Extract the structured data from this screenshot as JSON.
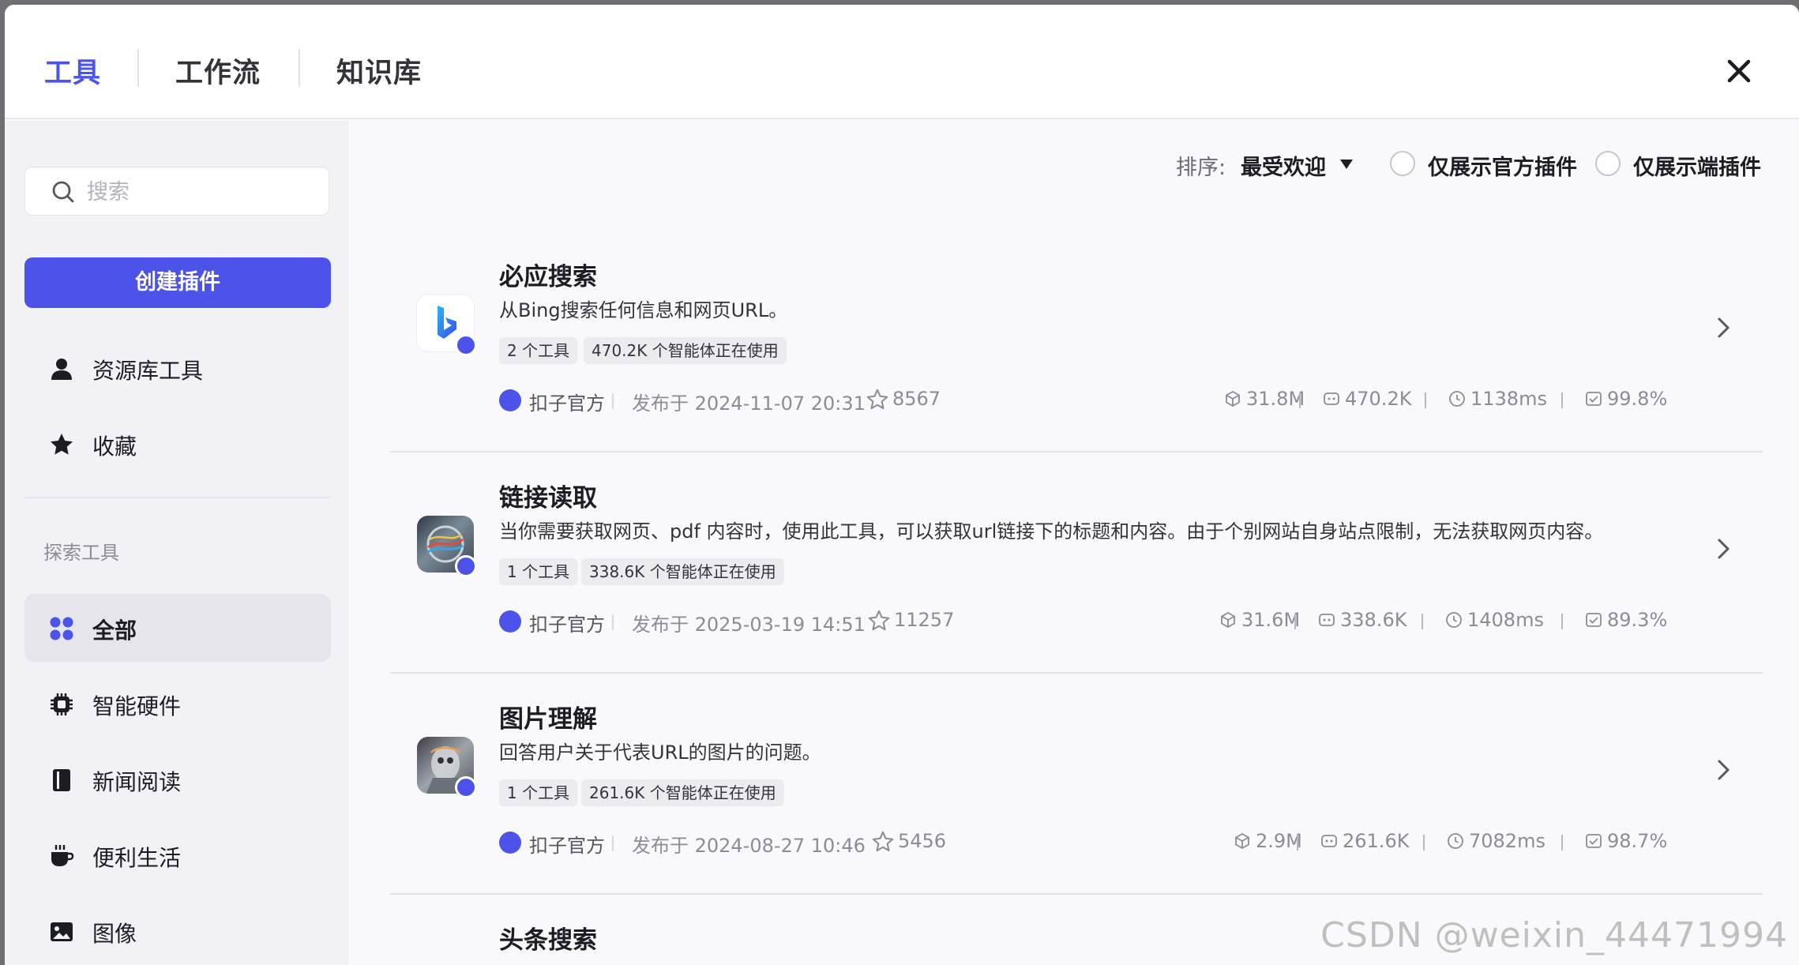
{
  "tabs": [
    {
      "label": "工具",
      "active": true
    },
    {
      "label": "工作流",
      "active": false
    },
    {
      "label": "知识库",
      "active": false
    }
  ],
  "sidebar": {
    "search_placeholder": "搜索",
    "create_label": "创建插件",
    "top_items": [
      {
        "label": "资源库工具",
        "icon": "user-icon"
      },
      {
        "label": "收藏",
        "icon": "star-icon"
      }
    ],
    "section_title": "探索工具",
    "categories": [
      {
        "label": "全部",
        "icon": "grid-icon",
        "active": true
      },
      {
        "label": "智能硬件",
        "icon": "chip-icon"
      },
      {
        "label": "新闻阅读",
        "icon": "book-icon"
      },
      {
        "label": "便利生活",
        "icon": "coffee-icon"
      },
      {
        "label": "图像",
        "icon": "image-icon"
      }
    ]
  },
  "toolbar": {
    "sort_label": "排序:",
    "sort_value": "最受欢迎",
    "filter_official": "仅展示官方插件",
    "filter_client": "仅展示端插件"
  },
  "plugins": [
    {
      "title": "必应搜索",
      "desc": "从Bing搜索任何信息和网页URL。",
      "tags": [
        "2 个工具",
        "470.2K 个智能体正在使用"
      ],
      "author": "扣子官方",
      "published": "发布于 2024-11-07 20:31",
      "stars": "8567",
      "stats": [
        "31.8M",
        "470.2K",
        "1138ms",
        "99.8%"
      ]
    },
    {
      "title": "链接读取",
      "desc": "当你需要获取网页、pdf 内容时，使用此工具，可以获取url链接下的标题和内容。由于个别网站自身站点限制，无法获取网页内容。",
      "tags": [
        "1 个工具",
        "338.6K 个智能体正在使用"
      ],
      "author": "扣子官方",
      "published": "发布于 2025-03-19 14:51",
      "stars": "11257",
      "stats": [
        "31.6M",
        "338.6K",
        "1408ms",
        "89.3%"
      ]
    },
    {
      "title": "图片理解",
      "desc": "回答用户关于代表URL的图片的问题。",
      "tags": [
        "1 个工具",
        "261.6K 个智能体正在使用"
      ],
      "author": "扣子官方",
      "published": "发布于 2024-08-27 10:46",
      "stars": "5456",
      "stats": [
        "2.9M",
        "261.6K",
        "7082ms",
        "98.7%"
      ]
    },
    {
      "title": "头条搜索"
    }
  ],
  "watermark": "CSDN @weixin_44471994",
  "colors": {
    "accent": "#4d53e8",
    "active_tab": "#4c54f0"
  }
}
